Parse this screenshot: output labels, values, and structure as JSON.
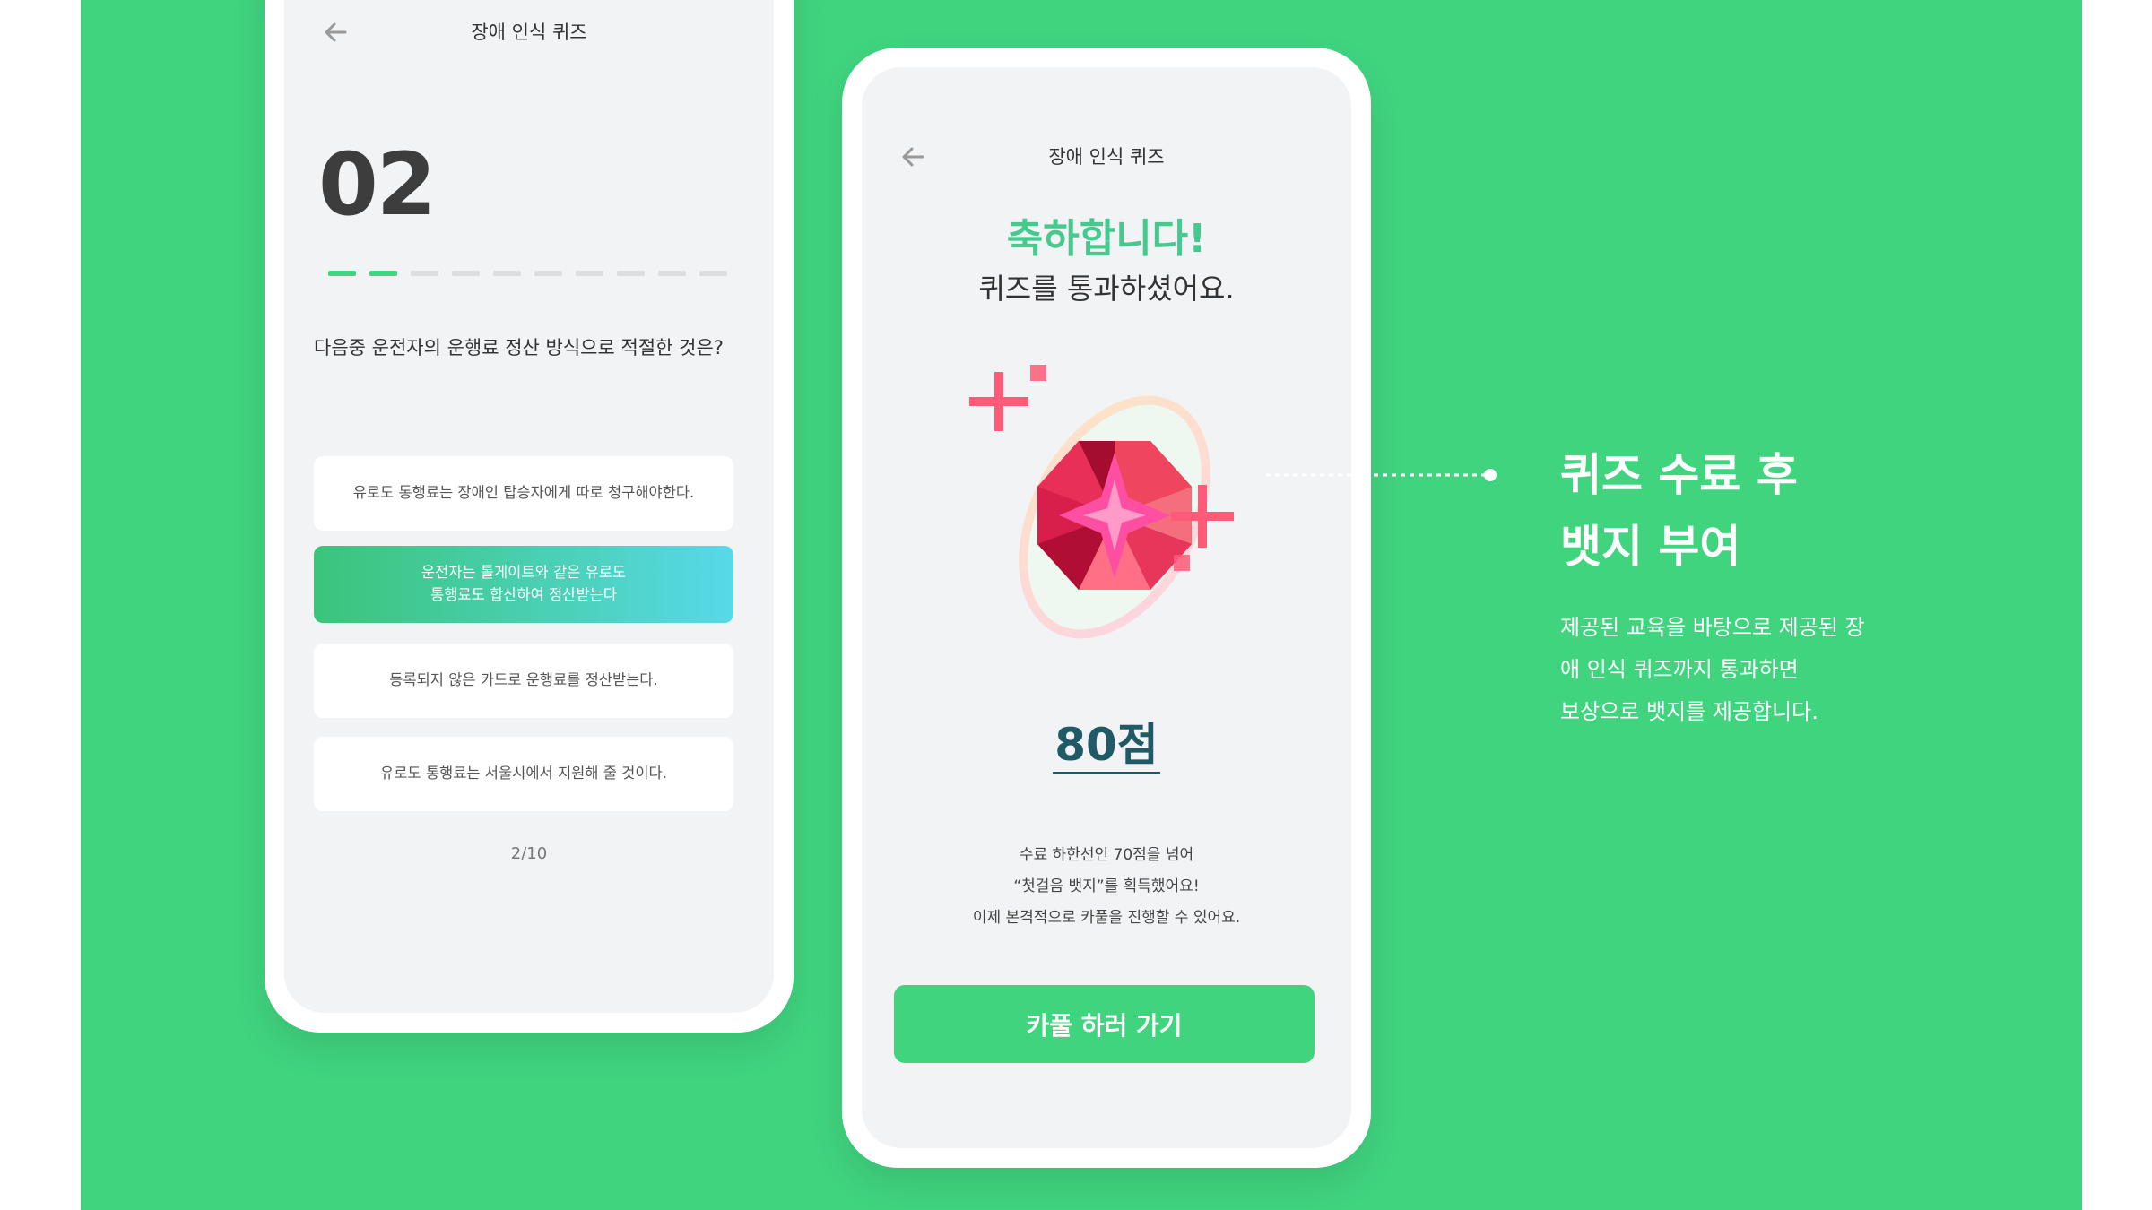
{
  "colors": {
    "brand_green": "#40d47f",
    "selected_gradient_start": "#3bc47a",
    "selected_gradient_end": "#57d9ea",
    "score_color": "#1f5a66",
    "congrats_color": "#46c98e"
  },
  "quiz_screen": {
    "title": "장애 인식 퀴즈",
    "back_icon": "arrow-left-icon",
    "question_number": "02",
    "progress": {
      "current": 2,
      "total": 10
    },
    "question": "다음중 운전자의 운행료 정산 방식으로  적절한 것은?",
    "options": [
      {
        "label": "유로도 통행료는 장애인 탑승자에게 따로 청구해야한다.",
        "selected": false
      },
      {
        "label": "운전자는 톨게이트와 같은 유로도\n통행료도 합산하여 정산받는다",
        "selected": true
      },
      {
        "label": "등록되지 않은 카드로 운행료를 정산받는다.",
        "selected": false
      },
      {
        "label": "유로도 통행료는 서울시에서 지원해 줄 것이다.",
        "selected": false
      }
    ],
    "pager": "2/10"
  },
  "result_screen": {
    "title": "장애 인식 퀴즈",
    "back_icon": "arrow-left-icon",
    "congrats": "축하합니다!",
    "passed": "퀴즈를 통과하셨어요.",
    "badge_icon": "ruby-badge-icon",
    "score": "80점",
    "description": [
      "수료 하한선인 70점을 넘어",
      "“첫걸음 뱃지”를 획득했어요!",
      "이제 본격적으로 카풀을 진행할 수 있어요."
    ],
    "cta": "카풀 하러 가기"
  },
  "annotation": {
    "title_lines": [
      "퀴즈 수료 후",
      "뱃지 부여"
    ],
    "desc_lines": [
      "제공된 교육을 바탕으로 제공된 장",
      "애 인식 퀴즈까지 통과하면",
      "보상으로 뱃지를 제공합니다."
    ]
  }
}
